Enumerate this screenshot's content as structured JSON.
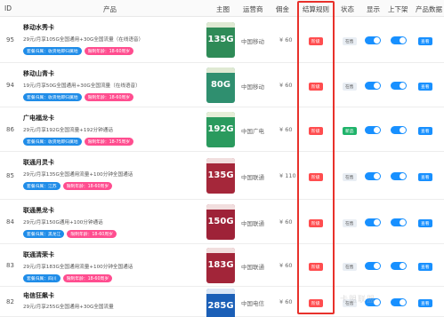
{
  "header": {
    "id": "ID",
    "product": "产品",
    "main_image": "主图",
    "operator": "运营商",
    "commission": "佣金",
    "settle_rule": "结算规则",
    "status": "状态",
    "display": "显示",
    "shelf": "上下架",
    "detail": "产品数据"
  },
  "rows": [
    {
      "id": "95",
      "name": "移动水秀卡",
      "desc": "29元/月享105G全国通用+30G全国流量（在线语音）",
      "tags": [
        {
          "t": "套餐归属：收货地即归属地",
          "c": "blue"
        },
        {
          "t": "限制年龄：18-60周岁",
          "c": "pink"
        }
      ],
      "thumb_gb": "135G",
      "thumb_color": "#2e8b57",
      "thumb_strip": "#dfe9d3",
      "operator": "中国移动",
      "price": "¥ 60",
      "rule": "阶级",
      "status": "在售",
      "status_kind": "on",
      "view": "查看"
    },
    {
      "id": "94",
      "name": "移动山青卡",
      "desc": "19元/月享50G全国通用+30G全国流量（在线语音）",
      "tags": [
        {
          "t": "套餐归属：收货地即归属地",
          "c": "blue"
        },
        {
          "t": "限制年龄：18-60周岁",
          "c": "pink"
        }
      ],
      "thumb_gb": "80G",
      "thumb_color": "#2f8f6f",
      "thumb_strip": "#dfe9d3",
      "operator": "中国移动",
      "price": "¥ 60",
      "rule": "阶级",
      "status": "在售",
      "status_kind": "on",
      "view": "查看"
    },
    {
      "id": "86",
      "name": "广电福龙卡",
      "desc": "29元/月享192G全国流量+192分钟通话",
      "tags": [
        {
          "t": "套餐归属：收货地即归属地",
          "c": "blue"
        },
        {
          "t": "限制年龄：18-75周岁",
          "c": "pink"
        }
      ],
      "thumb_gb": "192G",
      "thumb_color": "#2a9a5e",
      "thumb_strip": "#e6eed8",
      "operator": "中国广电",
      "price": "¥ 60",
      "rule": "阶级",
      "status": "新品",
      "status_kind": "new",
      "view": "查看"
    },
    {
      "id": "85",
      "name": "联通月灵卡",
      "desc": "29元/月享135G全国通用流量+100分钟全国通话",
      "tags": [
        {
          "t": "套餐归属：江苏",
          "c": "blue"
        },
        {
          "t": "限制年龄：18-60周岁",
          "c": "pink"
        }
      ],
      "thumb_gb": "135G",
      "thumb_color": "#a5273a",
      "thumb_strip": "#f1dede",
      "operator": "中国联通",
      "price": "¥ 110",
      "rule": "阶级",
      "status": "在售",
      "status_kind": "on",
      "view": "查看"
    },
    {
      "id": "84",
      "name": "联通黑龙卡",
      "desc": "29元/月享150G通用+100分钟通话",
      "tags": [
        {
          "t": "套餐归属：黑龙江",
          "c": "blue"
        },
        {
          "t": "限制年龄：18-60周岁",
          "c": "pink"
        }
      ],
      "thumb_gb": "150G",
      "thumb_color": "#9e2238",
      "thumb_strip": "#f1dede",
      "operator": "中国联通",
      "price": "¥ 60",
      "rule": "阶级",
      "status": "在售",
      "status_kind": "on",
      "view": "查看"
    },
    {
      "id": "83",
      "name": "联通清荣卡",
      "desc": "29元/月享183G全国通用流量+100分钟全国通话",
      "tags": [
        {
          "t": "套餐归属：四川",
          "c": "blue"
        },
        {
          "t": "限制年龄：18-60周岁",
          "c": "pink"
        }
      ],
      "thumb_gb": "183G",
      "thumb_color": "#a22539",
      "thumb_strip": "#f1dede",
      "operator": "中国联通",
      "price": "¥ 60",
      "rule": "阶级",
      "status": "在售",
      "status_kind": "on",
      "view": "查看"
    },
    {
      "id": "82",
      "name": "电信狂飙卡",
      "desc": "29元/月享255G全国通用+30G全国流量",
      "tags": [],
      "thumb_gb": "285G",
      "thumb_color": "#1b5fb7",
      "thumb_strip": "#dbe6f5",
      "operator": "中国电信",
      "price": "¥ 60",
      "rule": "阶级",
      "status": "在售",
      "status_kind": "on",
      "view": "查看"
    }
  ],
  "watermark": "卡盟联盟",
  "colors": {
    "highlight_box": "#e8312b",
    "switch_on": "#1890ff",
    "rule_badge": "#ff4d4f",
    "tag_blue": "#1f8ce8",
    "tag_pink": "#ff4d8f"
  }
}
